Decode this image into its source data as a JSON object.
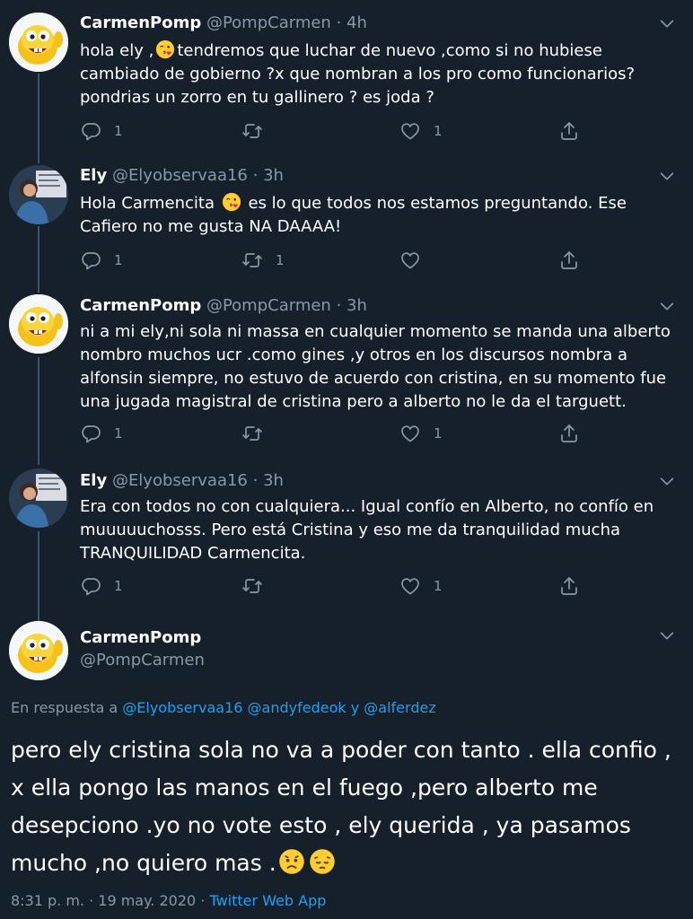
{
  "tweets": [
    {
      "name": "CarmenPomp",
      "handle": "@PompCarmen",
      "dot": "·",
      "time": "4h",
      "text_before": "hola ely ,",
      "text_after": "tendremos que luchar de nuevo ,como si no hubiese cambiado de gobierno ?x que nombran a los pro como funcionarios?pondrias un zorro en tu gallinero ? es joda ?",
      "replies": "1",
      "retweets": "",
      "likes": "1"
    },
    {
      "name": "Ely",
      "handle": "@Elyobservaa16",
      "dot": "·",
      "time": "3h",
      "text_before": "Hola Carmencita ",
      "text_after": " es lo que todos nos estamos preguntando. Ese Cafiero no me gusta NA DAAAA!",
      "replies": "1",
      "retweets": "1",
      "likes": ""
    },
    {
      "name": "CarmenPomp",
      "handle": "@PompCarmen",
      "dot": "·",
      "time": "3h",
      "text": "ni a mi ely,ni sola ni massa en cualquier momento se manda una alberto nombro muchos ucr .como gines ,y otros en los discursos nombra a alfonsin siempre, no estuvo de acuerdo con cristina, en su momento fue una jugada magistral de cristina pero a alberto no le da el targuett.",
      "replies": "1",
      "retweets": "",
      "likes": "1"
    },
    {
      "name": "Ely",
      "handle": "@Elyobservaa16",
      "dot": "·",
      "time": "3h",
      "text": "Era con todos no con cualquiera... Igual confío en Alberto, no confío  en muuuuuchosss. Pero está Cristina y eso me da tranquilidad mucha TRANQUILIDAD Carmencita.",
      "replies": "1",
      "retweets": "",
      "likes": "1"
    }
  ],
  "main_tweet": {
    "name": "CarmenPomp",
    "handle": "@PompCarmen",
    "reply_prefix": "En respuesta a ",
    "reply_user1": "@Elyobservaa16",
    "reply_user2": "@andyfedeok",
    "reply_and": " y ",
    "reply_user3": "@alferdez",
    "text": "pero ely cristina sola no va a poder con tanto . ella confio , x ella pongo las manos en el fuego ,pero alberto me desepciono .yo no vote esto , ely querida , ya pasamos mucho ,no quiero mas .",
    "timestamp": "8:31 p. m. · 19 may. 2020 · ",
    "source": "Twitter Web App"
  },
  "colors": {
    "background": "#15202b",
    "secondary_text": "#8899a6",
    "link": "#1da1f2",
    "thread_line": "#3d5466"
  },
  "icons": [
    "reply-icon",
    "retweet-icon",
    "like-icon",
    "share-icon",
    "chevron-down-icon",
    "kiss-emoji",
    "worried-emoji",
    "pensive-emoji"
  ]
}
